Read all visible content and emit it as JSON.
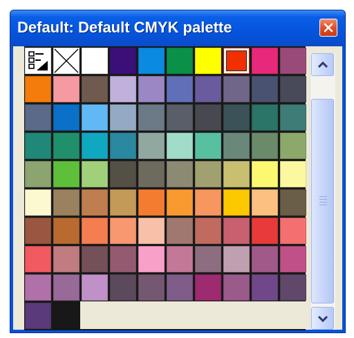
{
  "window": {
    "title": "Default: Default CMYK palette"
  },
  "icons": {
    "close": "close-icon",
    "scroll_up": "chevron-up-icon",
    "scroll_down": "chevron-down-icon",
    "color_docker": "color-docker-icon",
    "no_color": "no-color-icon"
  },
  "palette": {
    "special_swatches": [
      "color-docker",
      "no-color"
    ],
    "selected_color": "#f03000",
    "colors": [
      "#ffffff",
      "#3a1078",
      "#0a8ae0",
      "#0a9048",
      "#ffff00",
      "#f03000",
      "#e8287a",
      "#9a4a78",
      "#f47c0a",
      "#f49aa0",
      "#705a50",
      "#c0b0dc",
      "#9a88c4",
      "#6070b8",
      "#6a5a9e",
      "#70668a",
      "#4a5272",
      "#484a5a",
      "#5a6a88",
      "#0a70c8",
      "#60b8f4",
      "#94aac4",
      "#6c7a88",
      "#5a5e68",
      "#484850",
      "#3a5258",
      "#2a7468",
      "#3e7c78",
      "#208878",
      "#20906c",
      "#10a8c0",
      "#2a88a0",
      "#90a8a0",
      "#a0dcc8",
      "#58c0a0",
      "#6a887a",
      "#6a8a6a",
      "#8ca86a",
      "#8ca470",
      "#5ec03a",
      "#a0d07a",
      "#545046",
      "#6e6a5e",
      "#8c8a72",
      "#a0a070",
      "#c8c070",
      "#fcf870",
      "#fcf8a0",
      "#fcf8d0",
      "#9a8260",
      "#c07e50",
      "#c49a58",
      "#f47c30",
      "#f89a30",
      "#f89660",
      "#fcc800",
      "#fcc080",
      "#6a5e48",
      "#9a5640",
      "#b86a30",
      "#f47e50",
      "#f89870",
      "#f8c0a8",
      "#a07870",
      "#c06a60",
      "#c86070",
      "#e83a3a",
      "#f47070",
      "#f05a60",
      "#c07c80",
      "#745058",
      "#945a70",
      "#f8a0c8",
      "#c47898",
      "#8c6e80",
      "#c0a0b0",
      "#a05a8a",
      "#c05088",
      "#b070a8",
      "#986a98",
      "#c090c8",
      "#5c4a5c",
      "#745872",
      "#805c88",
      "#9e2a70",
      "#9a5a8a",
      "#70488a",
      "#60486a",
      "#5a3a7a",
      "#181818"
    ]
  }
}
